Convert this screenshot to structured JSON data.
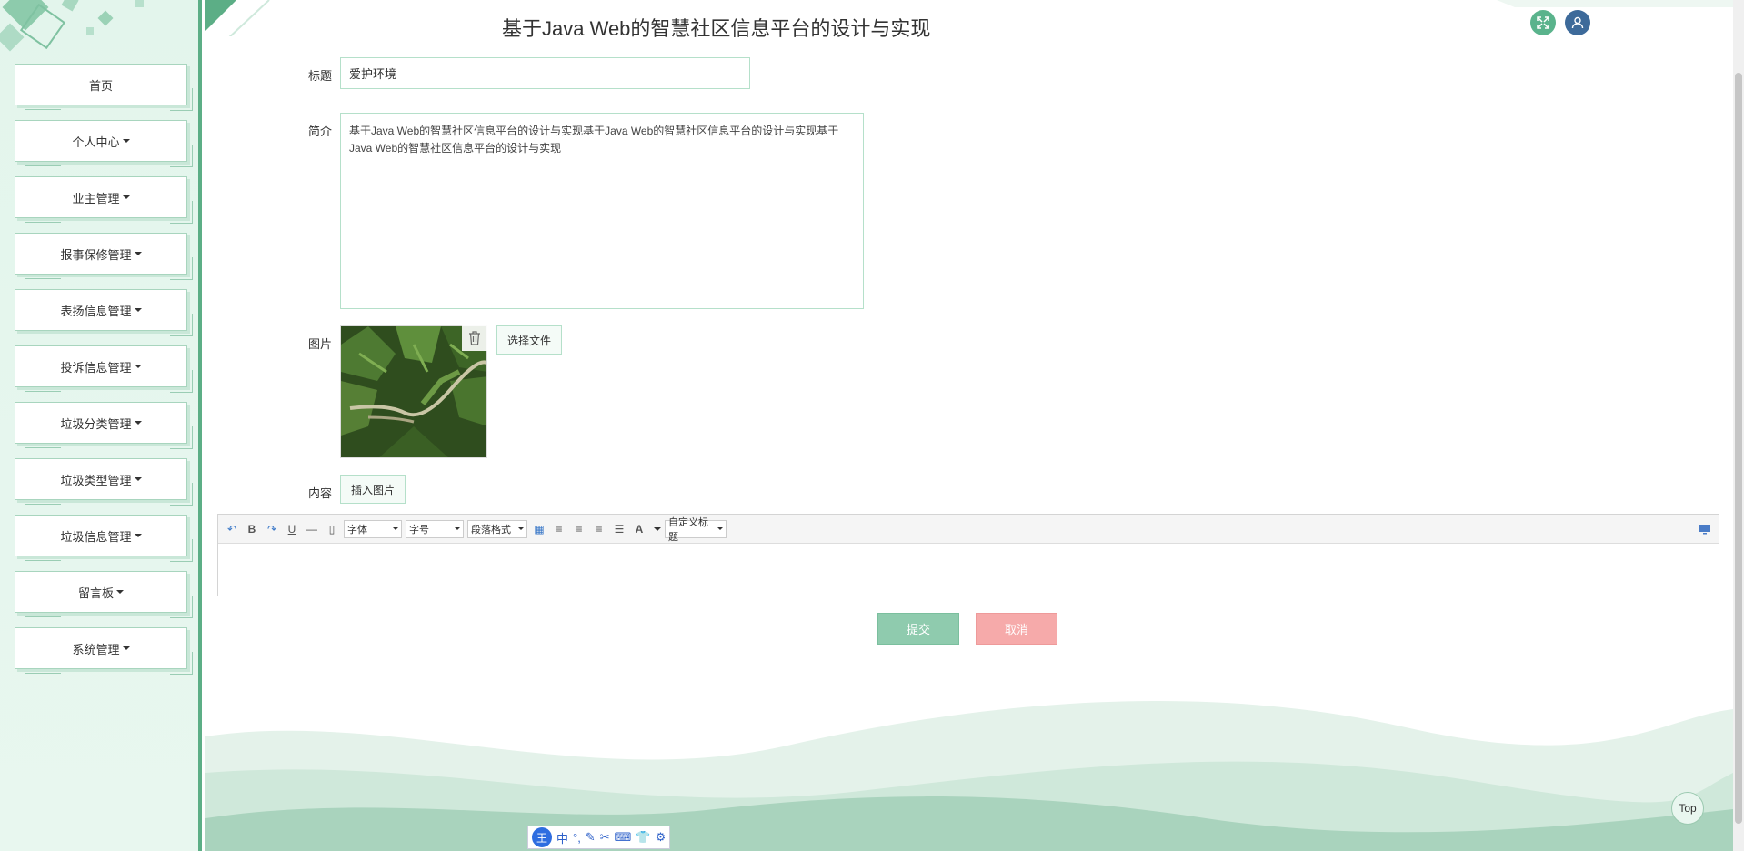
{
  "page": {
    "title": "基于Java Web的智慧社区信息平台的设计与实现"
  },
  "sidebar": {
    "items": [
      {
        "label": "首页",
        "has_caret": false
      },
      {
        "label": "个人中心",
        "has_caret": true
      },
      {
        "label": "业主管理",
        "has_caret": true
      },
      {
        "label": "报事保修管理",
        "has_caret": true
      },
      {
        "label": "表扬信息管理",
        "has_caret": true
      },
      {
        "label": "投诉信息管理",
        "has_caret": true
      },
      {
        "label": "垃圾分类管理",
        "has_caret": true
      },
      {
        "label": "垃圾类型管理",
        "has_caret": true
      },
      {
        "label": "垃圾信息管理",
        "has_caret": true
      },
      {
        "label": "留言板",
        "has_caret": true
      },
      {
        "label": "系统管理",
        "has_caret": true
      }
    ]
  },
  "header": {
    "fullscreen_icon": "expand-icon",
    "user_icon": "user-icon"
  },
  "form": {
    "title_label": "标题",
    "title_value": "爱护环境",
    "intro_label": "简介",
    "intro_value": "基于Java Web的智慧社区信息平台的设计与实现基于Java Web的智慧社区信息平台的设计与实现基于Java Web的智慧社区信息平台的设计与实现",
    "image_label": "图片",
    "choose_file_label": "选择文件",
    "content_label": "内容",
    "insert_image_label": "插入图片"
  },
  "editor": {
    "font_select": "字体",
    "size_select": "字号",
    "paragraph_select": "段落格式",
    "custom_title_select": "自定义标题"
  },
  "actions": {
    "submit_label": "提交",
    "cancel_label": "取消"
  },
  "top_button_label": "Top",
  "ime": {
    "logo": "王",
    "mode": "中",
    "punct": "°,"
  },
  "colors": {
    "accent": "#5cae86",
    "submit": "#8fcbae",
    "cancel": "#f6aaaa",
    "user_btn": "#3d6a9a"
  }
}
